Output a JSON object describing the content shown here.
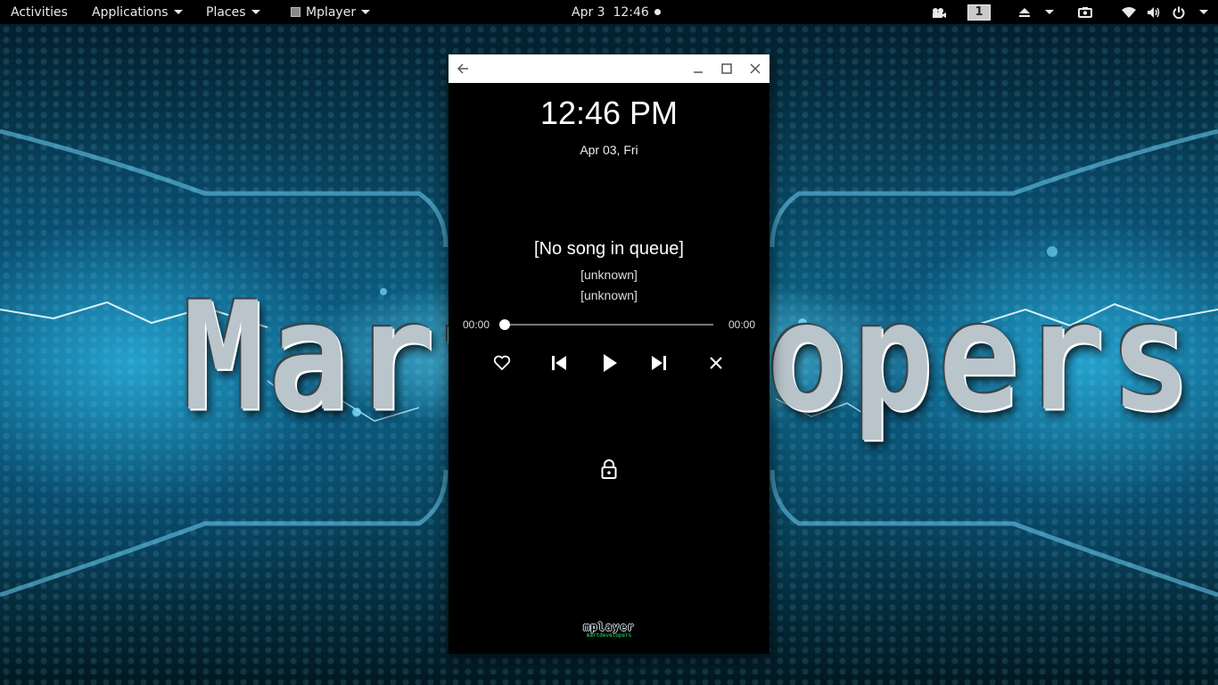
{
  "topbar": {
    "activities": "Activities",
    "applications": "Applications",
    "places": "Places",
    "app_menu": "Mplayer",
    "datetime": "Apr 3  12:46",
    "workspace": "1",
    "tray_icons": [
      "camera-icon",
      "workspace-indicator",
      "eject-icon",
      "screenshot-icon",
      "wifi-icon",
      "volume-icon",
      "power-icon"
    ]
  },
  "wallpaper": {
    "word_left": "Mart",
    "word_right": "opers"
  },
  "window": {
    "titlebar_icons": [
      "back-arrow-icon",
      "minimize-icon",
      "maximize-icon",
      "close-icon"
    ],
    "clock": "12:46 PM",
    "date": "Apr 03, Fri",
    "song_title": "[No song in queue]",
    "artist": "[unknown]",
    "album": "[unknown]",
    "elapsed": "00:00",
    "duration": "00:00",
    "progress": 0,
    "controls": [
      "heart-icon",
      "skip-previous-icon",
      "play-icon",
      "skip-next-icon",
      "close-icon"
    ],
    "lock_icon": "lock-icon",
    "logo": {
      "name": "mplayer",
      "subtitle": "martdevelopers"
    }
  },
  "colors": {
    "topbar_bg": "#000000",
    "window_bg": "#000000",
    "titlebar_bg": "#ffffff",
    "accent_wallpaper": "#0f6f92",
    "logo_sub": "#22ee66"
  }
}
